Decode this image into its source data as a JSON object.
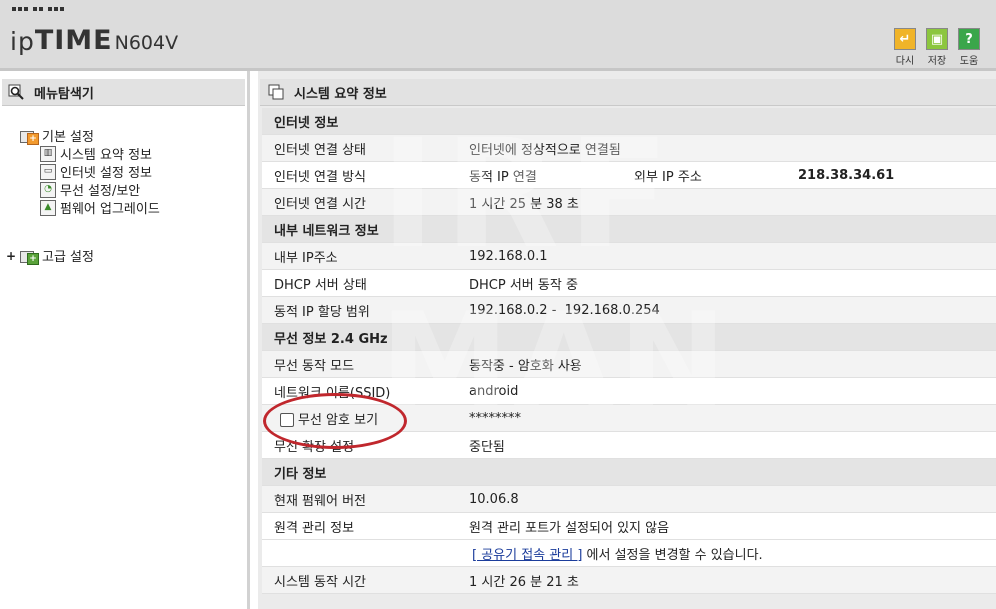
{
  "header": {
    "brand_ip": "ip",
    "brand_time": "TIME",
    "model": "N604V",
    "buttons": [
      {
        "label": "다시",
        "icon": "undo-icon",
        "color": "#f0b429"
      },
      {
        "label": "저장",
        "icon": "save-icon",
        "color": "#8cc63f"
      },
      {
        "label": "도움",
        "icon": "help-icon",
        "color": "#3aa64a"
      }
    ]
  },
  "sidebar": {
    "title": "메뉴탐색기",
    "basic": {
      "label": "기본 설정",
      "items": [
        {
          "label": "시스템 요약 정보",
          "icon": "bar-chart-icon"
        },
        {
          "label": "인터넷 설정 정보",
          "icon": "monitor-icon"
        },
        {
          "label": "무선 설정/보안",
          "icon": "wireless-icon"
        },
        {
          "label": "펌웨어 업그레이드",
          "icon": "upgrade-icon"
        }
      ]
    },
    "advanced": {
      "label": "고급 설정",
      "expand": "+"
    }
  },
  "main": {
    "title": "시스템 요약 정보",
    "sections": {
      "internet": "인터넷 정보",
      "lan": "내부 네트워크 정보",
      "wireless": "무선 정보 2.4 GHz",
      "etc": "기타 정보"
    },
    "internet": {
      "status_label": "인터넷 연결 상태",
      "status_value": "인터넷에 정상적으로 연결됨",
      "method_label": "인터넷 연결 방식",
      "method_value": "동적 IP 연결",
      "external_ip_label": "외부 IP 주소",
      "external_ip_value": "218.38.34.61",
      "time_label": "인터넷 연결 시간",
      "time_value": "1 시간 25 분 38 초"
    },
    "lan": {
      "ip_label": "내부 IP주소",
      "ip_value": "192.168.0.1",
      "dhcp_label": "DHCP 서버 상태",
      "dhcp_value": "DHCP 서버 동작 중",
      "range_label": "동적 IP 할당 범위",
      "range_value": "192.168.0.2 -  192.168.0.254"
    },
    "wireless": {
      "mode_label": "무선 동작 모드",
      "mode_value": "동작중 - 암호화 사용",
      "ssid_label": "네트워크 이름(SSID)",
      "ssid_value": "android",
      "show_pw_label": "무선 암호 보기",
      "pw_value": "********",
      "extend_label": "무선 확장 설정",
      "extend_value": "중단됨"
    },
    "etc": {
      "fw_label": "현재 펌웨어 버전",
      "fw_value": "10.06.8",
      "remote_label": "원격 관리 정보",
      "remote_value": "원격 관리 포트가 설정되어 있지 않음",
      "remote_link": "[ 공유기 접속 관리 ]",
      "remote_suffix": " 에서 설정을 변경할 수 있습니다.",
      "uptime_label": "시스템 동작 시간",
      "uptime_value": "1 시간 26 분 21 초"
    }
  },
  "watermark": {
    "line1": "IRF",
    "line2": "MAN"
  },
  "colors": {
    "annotation": "#c0272d"
  }
}
